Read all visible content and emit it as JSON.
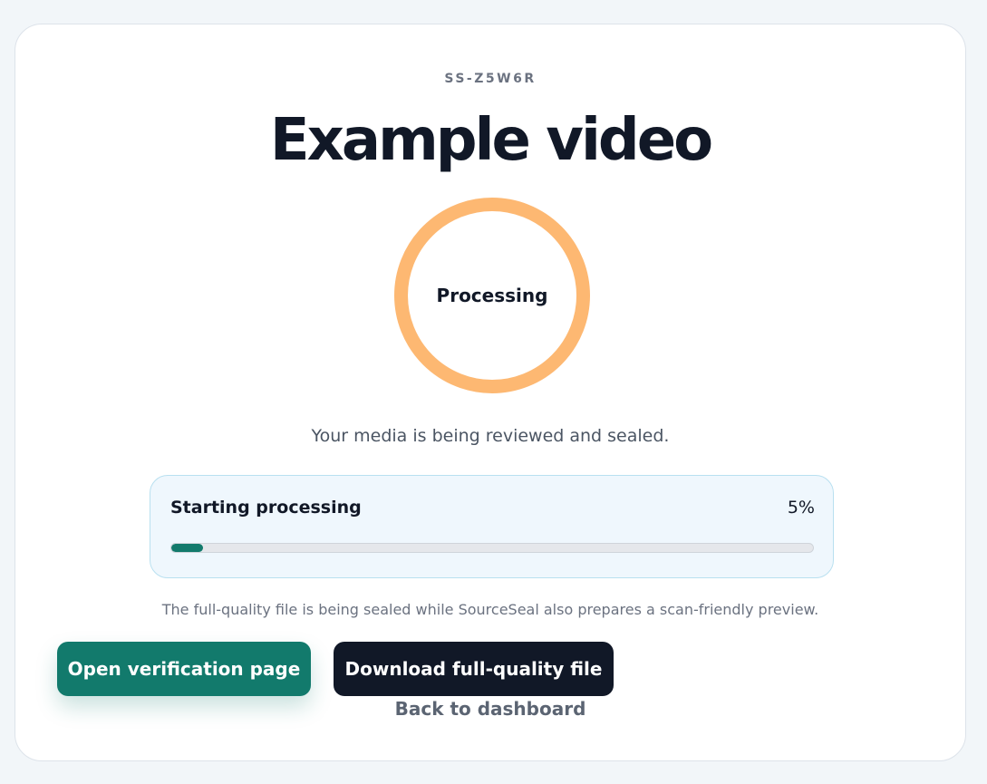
{
  "media": {
    "code": "SS-Z5W6R",
    "title": "Example video"
  },
  "status": {
    "ring_label": "Processing",
    "ring_color": "#fdb872",
    "message": "Your media is being reviewed and sealed."
  },
  "progress": {
    "label": "Starting processing",
    "percent_text": "5%",
    "value": 5,
    "fill_color": "#127a6c"
  },
  "note": "The full-quality file is being sealed while SourceSeal also prepares a scan-friendly preview.",
  "actions": {
    "verify_label": "Open verification page",
    "download_label": "Download full-quality file",
    "back_label": "Back to dashboard"
  },
  "colors": {
    "accent": "#127a6c",
    "dark": "#111827"
  }
}
